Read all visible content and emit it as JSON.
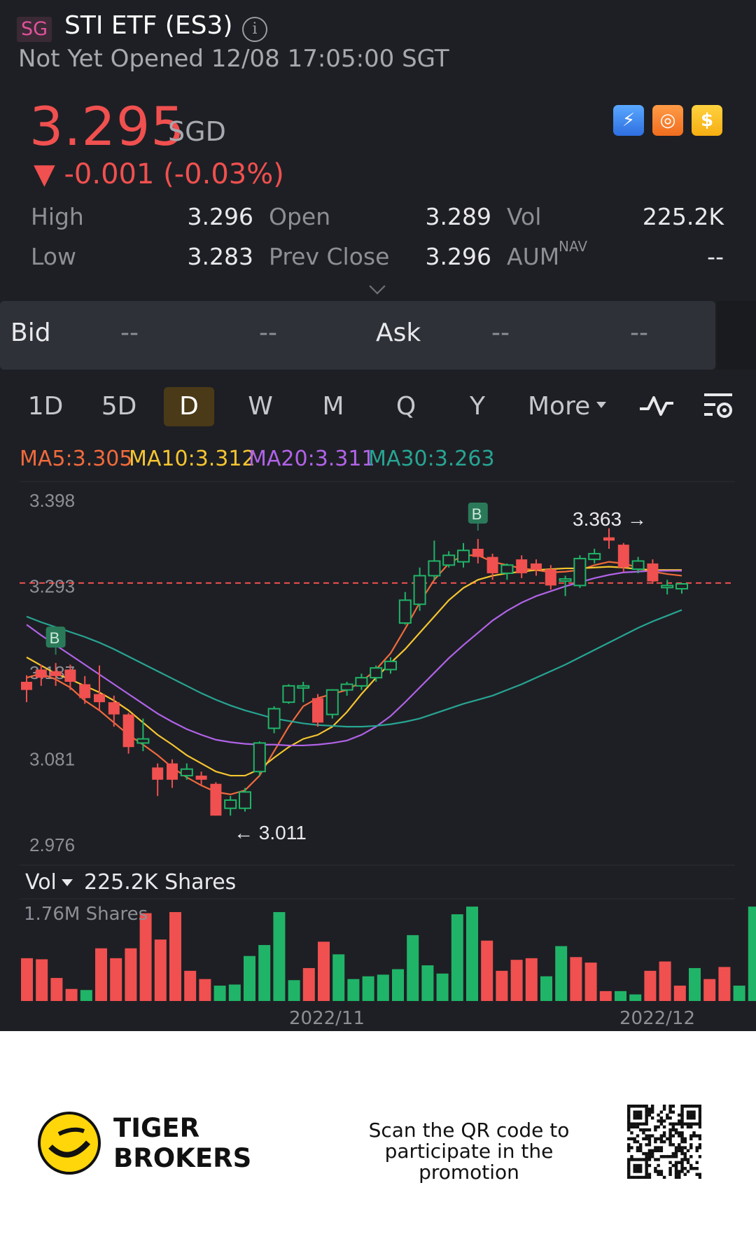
{
  "header": {
    "market": "SG",
    "title": "STI ETF (ES3)",
    "status": "Not Yet Opened 12/08 17:05:00 SGT",
    "price": "3.295",
    "currency": "SGD",
    "change": "▼ -0.001 (-0.03%)",
    "badges": [
      "lightning-icon",
      "basketball-icon",
      "dollar-icon"
    ],
    "stats": [
      {
        "label": "High",
        "value": "3.296"
      },
      {
        "label": "Open",
        "value": "3.289"
      },
      {
        "label": "Vol",
        "value": "225.2K"
      },
      {
        "label": "Low",
        "value": "3.283"
      },
      {
        "label": "Prev Close",
        "value": "3.296"
      },
      {
        "label": "AUM",
        "value": "--",
        "sup": "NAV"
      }
    ]
  },
  "bidask": {
    "bid_label": "Bid",
    "ask_label": "Ask",
    "dash": "--"
  },
  "tabs": {
    "items": [
      "1D",
      "5D",
      "D",
      "W",
      "M",
      "Q",
      "Y",
      "More"
    ],
    "active": "D"
  },
  "ma_legend": [
    {
      "text": "MA5:3.305",
      "color": "#f06a3c"
    },
    {
      "text": "MA10:3.312",
      "color": "#f5c530"
    },
    {
      "text": "MA20:3.311",
      "color": "#b163e8"
    },
    {
      "text": "MA30:3.263",
      "color": "#27a593"
    }
  ],
  "chart_data": {
    "type": "candlestick",
    "ylim": [
      2.976,
      3.398
    ],
    "y_ticks": [
      "3.398",
      "3.293",
      "3.187",
      "3.081",
      "2.976"
    ],
    "high_label": "3.363",
    "low_label": "3.011",
    "buy_marker": "B",
    "x_labels": [
      "2022/11",
      "2022/12"
    ],
    "candles": [
      [
        3.165,
        3.175,
        3.15,
        3.183,
        "d"
      ],
      [
        3.18,
        3.19,
        3.17,
        3.196,
        "d"
      ],
      [
        3.188,
        3.182,
        3.17,
        3.198,
        "d"
      ],
      [
        3.19,
        3.175,
        3.165,
        3.196,
        "d"
      ],
      [
        3.172,
        3.155,
        3.148,
        3.182,
        "d"
      ],
      [
        3.16,
        3.15,
        3.14,
        3.195,
        "d"
      ],
      [
        3.15,
        3.135,
        3.12,
        3.158,
        "d"
      ],
      [
        3.135,
        3.095,
        3.087,
        3.137,
        "d"
      ],
      [
        3.1,
        3.105,
        3.09,
        3.13,
        "u"
      ],
      [
        3.07,
        3.055,
        3.035,
        3.075,
        "d"
      ],
      [
        3.075,
        3.055,
        3.045,
        3.08,
        "d"
      ],
      [
        3.06,
        3.068,
        3.055,
        3.075,
        "u"
      ],
      [
        3.06,
        3.055,
        3.048,
        3.065,
        "d"
      ],
      [
        3.05,
        3.011,
        3.011,
        3.052,
        "d"
      ],
      [
        3.02,
        3.03,
        3.011,
        3.035,
        "u"
      ],
      [
        3.02,
        3.04,
        3.016,
        3.045,
        "u"
      ],
      [
        3.065,
        3.1,
        3.06,
        3.102,
        "u"
      ],
      [
        3.118,
        3.142,
        3.112,
        3.145,
        "u"
      ],
      [
        3.15,
        3.17,
        3.148,
        3.172,
        "u"
      ],
      [
        3.17,
        3.17,
        3.15,
        3.175,
        "u"
      ],
      [
        3.155,
        3.125,
        3.12,
        3.16,
        "d"
      ],
      [
        3.135,
        3.165,
        3.13,
        3.166,
        "u"
      ],
      [
        3.165,
        3.172,
        3.158,
        3.175,
        "u"
      ],
      [
        3.17,
        3.18,
        3.165,
        3.185,
        "u"
      ],
      [
        3.18,
        3.192,
        3.175,
        3.195,
        "u"
      ],
      [
        3.19,
        3.2,
        3.185,
        3.205,
        "u"
      ],
      [
        3.247,
        3.275,
        3.245,
        3.285,
        "u"
      ],
      [
        3.27,
        3.305,
        3.262,
        3.315,
        "u"
      ],
      [
        3.305,
        3.323,
        3.3,
        3.348,
        "u"
      ],
      [
        3.318,
        3.33,
        3.315,
        3.335,
        "u"
      ],
      [
        3.322,
        3.336,
        3.315,
        3.345,
        "u"
      ],
      [
        3.338,
        3.328,
        3.32,
        3.35,
        "d"
      ],
      [
        3.328,
        3.308,
        3.3,
        3.332,
        "d"
      ],
      [
        3.308,
        3.318,
        3.3,
        3.32,
        "u"
      ],
      [
        3.325,
        3.308,
        3.302,
        3.33,
        "d"
      ],
      [
        3.32,
        3.312,
        3.305,
        3.325,
        "d"
      ],
      [
        3.313,
        3.293,
        3.288,
        3.318,
        "d"
      ],
      [
        3.3,
        3.301,
        3.28,
        3.305,
        "u"
      ],
      [
        3.293,
        3.326,
        3.29,
        3.33,
        "u"
      ],
      [
        3.325,
        3.332,
        3.32,
        3.338,
        "u"
      ],
      [
        3.352,
        3.348,
        3.338,
        3.363,
        "d"
      ],
      [
        3.343,
        3.315,
        3.31,
        3.345,
        "d"
      ],
      [
        3.313,
        3.323,
        3.308,
        3.328,
        "u"
      ],
      [
        3.32,
        3.298,
        3.295,
        3.325,
        "d"
      ],
      [
        3.293,
        3.293,
        3.282,
        3.3,
        "u"
      ],
      [
        3.289,
        3.295,
        3.283,
        3.296,
        "u"
      ]
    ],
    "ma": {
      "MA5": [
        3.18,
        3.185,
        3.178,
        3.168,
        3.152,
        3.14,
        3.125,
        3.11,
        3.098,
        3.085,
        3.07,
        3.058,
        3.048,
        3.04,
        3.037,
        3.042,
        3.06,
        3.09,
        3.12,
        3.145,
        3.155,
        3.16,
        3.165,
        3.175,
        3.19,
        3.21,
        3.24,
        3.272,
        3.3,
        3.32,
        3.33,
        3.33,
        3.322,
        3.318,
        3.314,
        3.312,
        3.309,
        3.31,
        3.312,
        3.318,
        3.322,
        3.32,
        3.315,
        3.31,
        3.307,
        3.305
      ],
      "MA10": [
        3.205,
        3.195,
        3.185,
        3.178,
        3.17,
        3.162,
        3.152,
        3.14,
        3.125,
        3.11,
        3.098,
        3.085,
        3.075,
        3.065,
        3.06,
        3.06,
        3.068,
        3.082,
        3.095,
        3.105,
        3.11,
        3.12,
        3.138,
        3.16,
        3.18,
        3.198,
        3.215,
        3.235,
        3.255,
        3.275,
        3.29,
        3.3,
        3.305,
        3.308,
        3.31,
        3.312,
        3.313,
        3.314,
        3.314,
        3.315,
        3.316,
        3.315,
        3.313,
        3.312,
        3.312,
        3.312
      ],
      "MA20": [
        3.245,
        3.232,
        3.22,
        3.208,
        3.196,
        3.184,
        3.172,
        3.16,
        3.148,
        3.136,
        3.126,
        3.117,
        3.11,
        3.104,
        3.101,
        3.099,
        3.098,
        3.098,
        3.097,
        3.097,
        3.098,
        3.1,
        3.103,
        3.11,
        3.12,
        3.133,
        3.15,
        3.168,
        3.186,
        3.204,
        3.22,
        3.235,
        3.25,
        3.262,
        3.272,
        3.28,
        3.286,
        3.292,
        3.297,
        3.302,
        3.306,
        3.309,
        3.31,
        3.311,
        3.311,
        3.311
      ],
      "MA30": [
        3.255,
        3.248,
        3.242,
        3.236,
        3.23,
        3.223,
        3.215,
        3.206,
        3.197,
        3.188,
        3.179,
        3.17,
        3.161,
        3.153,
        3.146,
        3.14,
        3.135,
        3.13,
        3.127,
        3.124,
        3.122,
        3.121,
        3.12,
        3.12,
        3.121,
        3.123,
        3.126,
        3.13,
        3.136,
        3.142,
        3.148,
        3.153,
        3.158,
        3.165,
        3.172,
        3.18,
        3.188,
        3.196,
        3.205,
        3.214,
        3.223,
        3.232,
        3.241,
        3.249,
        3.256,
        3.263
      ]
    },
    "prev_close_line": 3.296,
    "buy_marker_indices": [
      2,
      31
    ]
  },
  "volume": {
    "label": "Vol",
    "value": "225.2K Shares",
    "max_label": "1.76M Shares",
    "max": 1.76,
    "bars": [
      0.78,
      0.76,
      0.42,
      0.22,
      0.2,
      0.96,
      0.78,
      0.96,
      1.6,
      1.12,
      1.62,
      0.55,
      0.4,
      0.28,
      0.3,
      0.82,
      1.02,
      1.62,
      0.38,
      0.6,
      1.08,
      0.85,
      0.4,
      0.45,
      0.48,
      0.58,
      1.2,
      0.65,
      0.5,
      1.58,
      1.72,
      1.1,
      0.55,
      0.75,
      0.78,
      0.45,
      1.0,
      0.8,
      0.7,
      0.18,
      0.18,
      0.12,
      0.55,
      0.72,
      0.28,
      0.6,
      0.4,
      0.62,
      0.28,
      1.72,
      0.2
    ],
    "colors": "ddddudddddddduuuuuudduuuuuuuuuudddduuddduudddudduu"
  },
  "footer": {
    "brand": "TIGER\nBROKERS",
    "promo": "Scan the QR code to participate in the promotion"
  },
  "colors": {
    "up": "#20b468",
    "down": "#f0504f",
    "background": "#1e1f24"
  }
}
